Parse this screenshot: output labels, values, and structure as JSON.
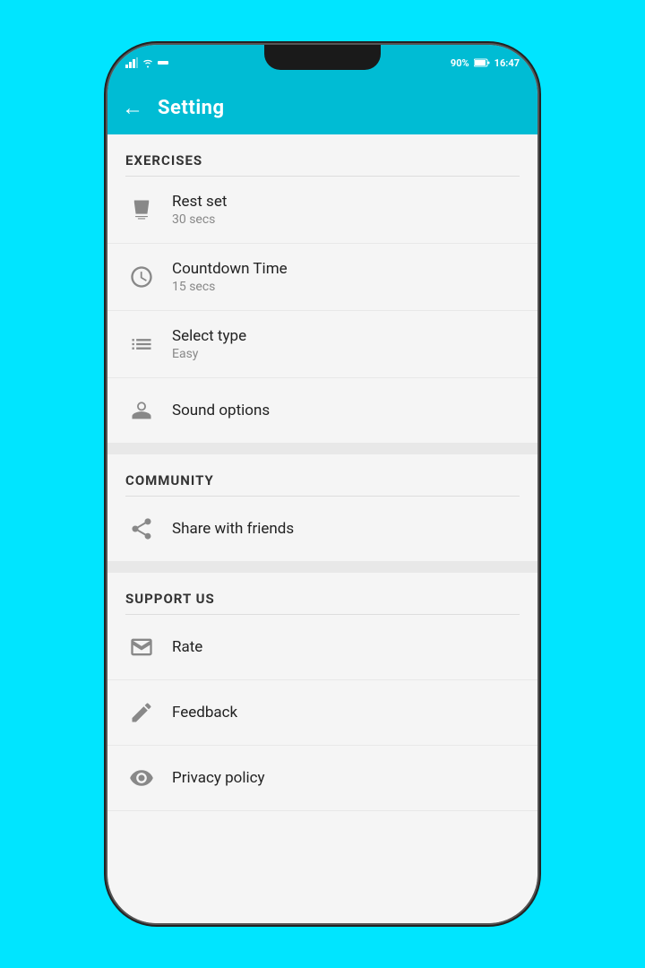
{
  "statusBar": {
    "time": "16:47",
    "battery": "90%",
    "signal": "▉▉▉"
  },
  "header": {
    "title": "Setting",
    "backLabel": "←"
  },
  "sections": [
    {
      "id": "exercises",
      "label": "EXERCISES",
      "items": [
        {
          "id": "rest-set",
          "label": "Rest set",
          "sublabel": "30 secs",
          "icon": "cup"
        },
        {
          "id": "countdown-time",
          "label": "Countdown Time",
          "sublabel": "15 secs",
          "icon": "clock"
        },
        {
          "id": "select-type",
          "label": "Select type",
          "sublabel": "Easy",
          "icon": "list"
        },
        {
          "id": "sound-options",
          "label": "Sound options",
          "sublabel": "",
          "icon": "sound"
        }
      ]
    },
    {
      "id": "community",
      "label": "COMMUNITY",
      "items": [
        {
          "id": "share",
          "label": "Share with friends",
          "sublabel": "",
          "icon": "share"
        }
      ]
    },
    {
      "id": "support",
      "label": "SUPPORT US",
      "items": [
        {
          "id": "rate",
          "label": "Rate",
          "sublabel": "",
          "icon": "rate"
        },
        {
          "id": "feedback",
          "label": "Feedback",
          "sublabel": "",
          "icon": "pencil"
        },
        {
          "id": "privacy",
          "label": "Privacy policy",
          "sublabel": "",
          "icon": "eye"
        }
      ]
    }
  ]
}
